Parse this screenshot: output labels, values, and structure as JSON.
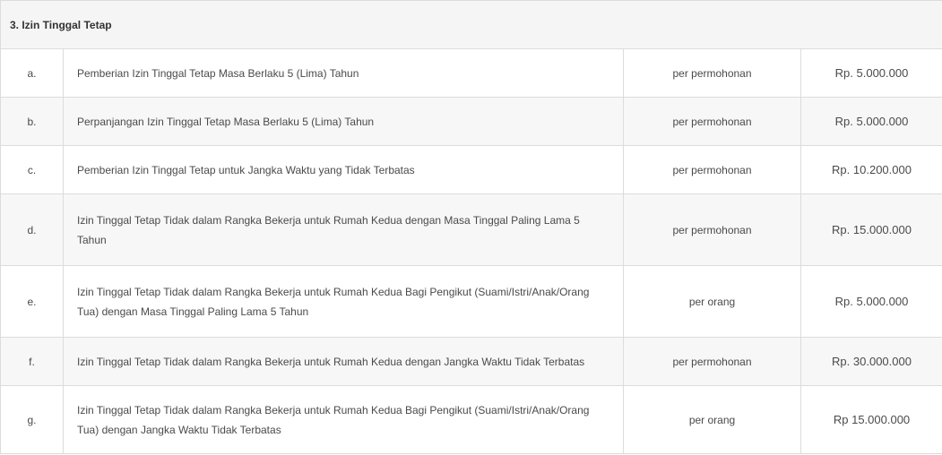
{
  "section": {
    "title": "3. Izin Tinggal Tetap"
  },
  "rows": [
    {
      "letter": "a.",
      "description": "Pemberian Izin Tinggal Tetap Masa Berlaku 5 (Lima) Tahun",
      "unit": "per permohonan",
      "fee": "Rp. 5.000.000"
    },
    {
      "letter": "b.",
      "description": "Perpanjangan Izin Tinggal Tetap Masa Berlaku 5 (Lima) Tahun",
      "unit": "per permohonan",
      "fee": "Rp. 5.000.000"
    },
    {
      "letter": "c.",
      "description": "Pemberian Izin Tinggal Tetap untuk Jangka Waktu yang Tidak Terbatas",
      "unit": "per permohonan",
      "fee": "Rp. 10.200.000"
    },
    {
      "letter": "d.",
      "description": "Izin Tinggal Tetap Tidak dalam Rangka Bekerja untuk Rumah Kedua dengan Masa Tinggal Paling Lama 5 Tahun",
      "unit": "per permohonan",
      "fee": "Rp. 15.000.000"
    },
    {
      "letter": "e.",
      "description": "Izin Tinggal Tetap Tidak dalam Rangka Bekerja untuk Rumah Kedua Bagi Pengikut (Suami/Istri/Anak/Orang Tua) dengan Masa Tinggal Paling Lama 5 Tahun",
      "unit": "per orang",
      "fee": "Rp. 5.000.000"
    },
    {
      "letter": "f.",
      "description": "Izin Tinggal Tetap Tidak dalam Rangka Bekerja untuk Rumah Kedua dengan Jangka Waktu Tidak Terbatas",
      "unit": "per permohonan",
      "fee": "Rp. 30.000.000"
    },
    {
      "letter": "g.",
      "description": "Izin Tinggal Tetap Tidak dalam Rangka Bekerja untuk Rumah Kedua Bagi Pengikut (Suami/Istri/Anak/Orang Tua) dengan Jangka Waktu Tidak Terbatas",
      "unit": "per orang",
      "fee": "Rp 15.000.000"
    }
  ]
}
